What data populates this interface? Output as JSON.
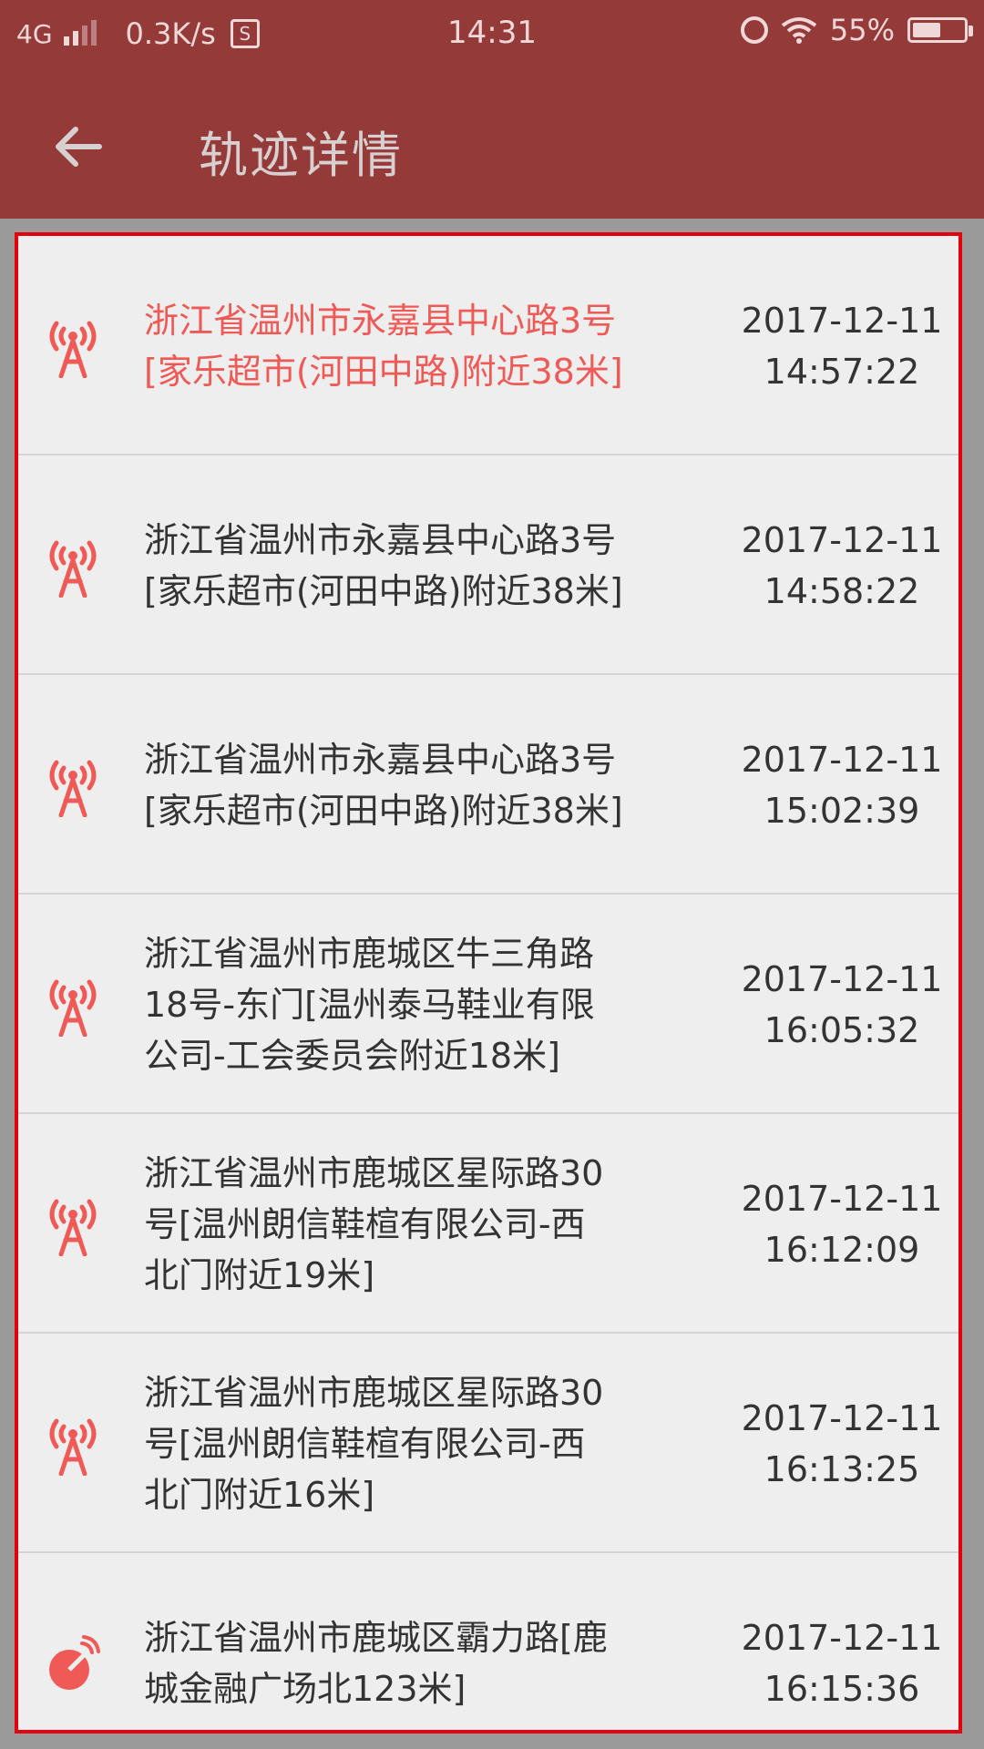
{
  "status_bar": {
    "network": "4G",
    "speed": "0.3K/s",
    "s_badge": "S",
    "time": "14:31",
    "battery": "55%",
    "battery_level": 0.55
  },
  "header": {
    "title": "轨迹详情",
    "back_icon": "arrow-left-icon"
  },
  "colors": {
    "bar": "#943a39",
    "accent": "#ef5a56",
    "highlight_border": "#e3000f"
  },
  "records": [
    {
      "icon": "signal-tower-icon",
      "address": [
        "浙江省温州市永嘉县中心路3号",
        "[家乐超市(河田中路)附近38米]"
      ],
      "date": "2017-12-11",
      "time": "14:57:22",
      "active": true
    },
    {
      "icon": "signal-tower-icon",
      "address": [
        "浙江省温州市永嘉县中心路3号",
        "[家乐超市(河田中路)附近38米]"
      ],
      "date": "2017-12-11",
      "time": "14:58:22",
      "active": false
    },
    {
      "icon": "signal-tower-icon",
      "address": [
        "浙江省温州市永嘉县中心路3号",
        "[家乐超市(河田中路)附近38米]"
      ],
      "date": "2017-12-11",
      "time": "15:02:39",
      "active": false
    },
    {
      "icon": "signal-tower-icon",
      "address": [
        "浙江省温州市鹿城区牛三角路",
        "18号-东门[温州泰马鞋业有限",
        "公司-工会委员会附近18米]"
      ],
      "date": "2017-12-11",
      "time": "16:05:32",
      "active": false
    },
    {
      "icon": "signal-tower-icon",
      "address": [
        "浙江省温州市鹿城区星际路30",
        "号[温州朗信鞋楦有限公司-西",
        "北门附近19米]"
      ],
      "date": "2017-12-11",
      "time": "16:12:09",
      "active": false
    },
    {
      "icon": "signal-tower-icon",
      "address": [
        "浙江省温州市鹿城区星际路30",
        "号[温州朗信鞋楦有限公司-西",
        "北门附近16米]"
      ],
      "date": "2017-12-11",
      "time": "16:13:25",
      "active": false
    },
    {
      "icon": "satellite-dish-icon",
      "address": [
        "浙江省温州市鹿城区霸力路[鹿",
        "城金融广场北123米]"
      ],
      "date": "2017-12-11",
      "time": "16:15:36",
      "active": false
    }
  ]
}
